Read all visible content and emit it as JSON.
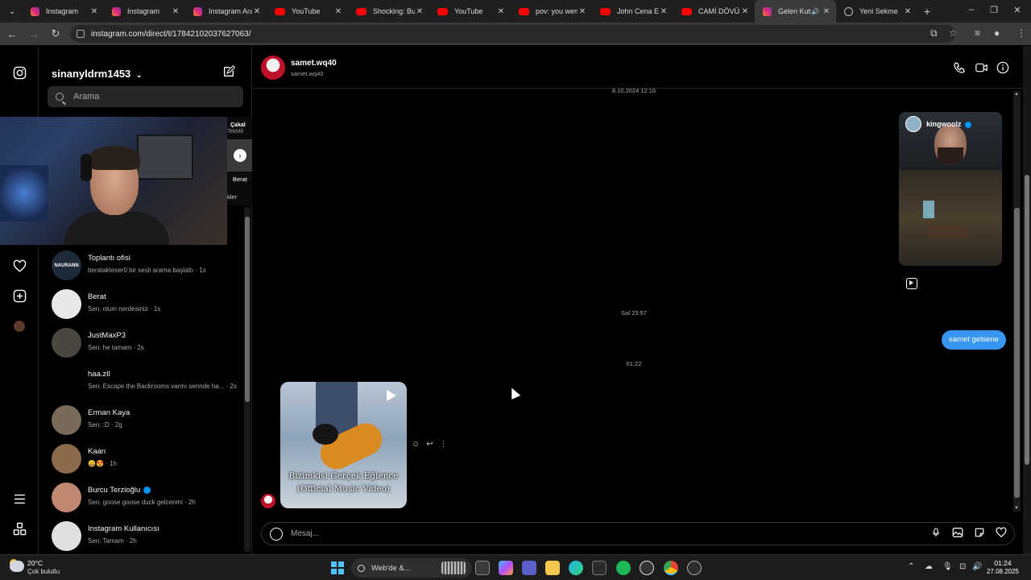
{
  "browser": {
    "tabs": [
      {
        "label": "Instagram",
        "favicon": "instagram-icon"
      },
      {
        "label": "Instagram",
        "favicon": "instagram-icon"
      },
      {
        "label": "Instagram Aramas",
        "favicon": "instagram-icon"
      },
      {
        "label": "YouTube",
        "favicon": "youtube-icon"
      },
      {
        "label": "Shocking: Bull",
        "favicon": "youtube-icon"
      },
      {
        "label": "YouTube",
        "favicon": "youtube-icon"
      },
      {
        "label": "pov: you went",
        "favicon": "youtube-icon"
      },
      {
        "label": "John Cena Ente",
        "favicon": "youtube-icon"
      },
      {
        "label": "CAMİ DÖVÜŞÇ",
        "favicon": "youtube-icon"
      },
      {
        "label": "Gelen Kutu",
        "favicon": "instagram-icon"
      },
      {
        "label": "Yeni Sekme",
        "favicon": "globe-icon"
      }
    ],
    "active_tab_index": 9,
    "url": "instagram.com/direct/t/17842102037627063/"
  },
  "instagram": {
    "account_username": "sinanyldrm1453",
    "search_placeholder": "Arama",
    "conversations": [
      {
        "name": "Toplantı ofisi",
        "last_message": "beratakteser0 bir sesli arama başlattı · 1s",
        "avatar_color": "#1d2a3a",
        "avatar_text": "NAURANN"
      },
      {
        "name": "Berat",
        "last_message": "Sen: olum nerdesiniz · 1s",
        "avatar_color": "#e8e8e8",
        "avatar_text": ""
      },
      {
        "name": "JustMaxP3",
        "last_message": "Sen: he tamam · 2s",
        "avatar_color": "#4a4640",
        "avatar_text": ""
      },
      {
        "name": "haa.zll",
        "last_message": "Sen: Escape the Backrooms varmı sennde ha... · 2s",
        "avatar_color": "#000000",
        "avatar_text": ""
      },
      {
        "name": "Erman Kaya",
        "last_message": "Sen: :D · 2g",
        "avatar_color": "#7a6a5a",
        "avatar_text": ""
      },
      {
        "name": "Kaan",
        "last_message": "😄😍 · 1h",
        "avatar_color": "#8a6a4a",
        "avatar_text": ""
      },
      {
        "name": "Burcu Terzioğlu",
        "last_message": "Sen: goose goose duck gelcenmi · 2h",
        "avatar_color": "#c08870",
        "avatar_text": "",
        "verified": true
      },
      {
        "name": "Instagram Kullanıcısı",
        "last_message": "Sen: Tamam · 2h",
        "avatar_color": "#e0e0e0",
        "avatar_text": ""
      }
    ],
    "story_partial": {
      "title": "Çakal",
      "subtitle": "TekMil",
      "name": "Berat",
      "note": "kler"
    }
  },
  "chat": {
    "contact_name": "samet.wq40",
    "contact_username": "samet.wq40",
    "timestamps": [
      "8.10.2024 12:16",
      "Sal 23:57",
      "01:22"
    ],
    "shared_reel": {
      "account": "kingwoolz",
      "verified": true
    },
    "my_message": "samet gelsene",
    "video_caption_line1": "Bizimkisi Gerçek Eğlence",
    "video_caption_line2": "(Official Music Video)",
    "composer_placeholder": "Mesaj..."
  },
  "taskbar": {
    "temperature": "20°C",
    "weather": "Çok bulutlu",
    "search_label": "Web'de &...",
    "time": "01:24",
    "date": "27.08.2025"
  }
}
